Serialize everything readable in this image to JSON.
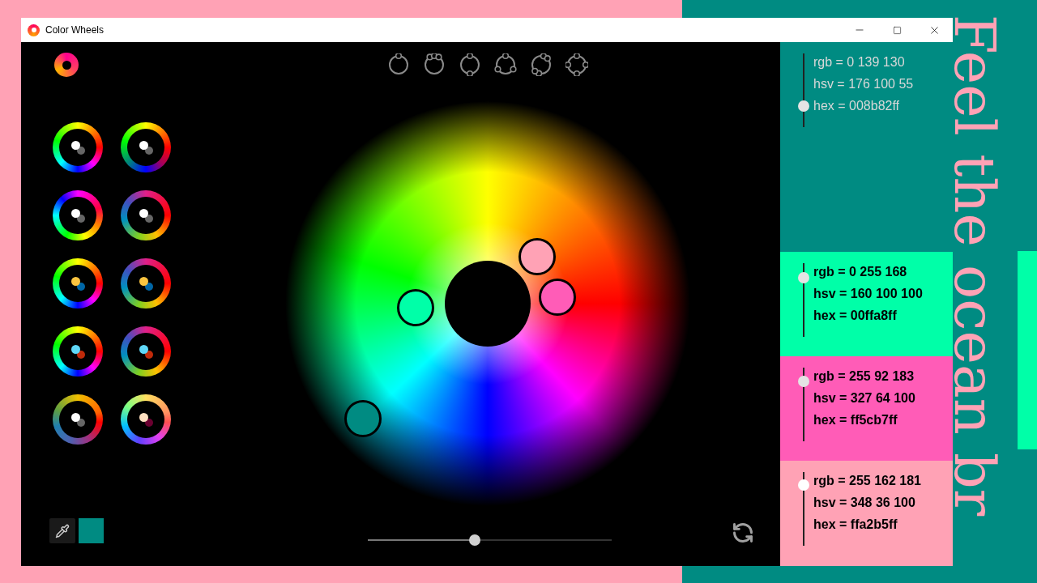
{
  "window": {
    "title": "Color Wheels"
  },
  "presets": [
    {
      "kind": "rgb",
      "dots": [
        {
          "color": "#ffffff"
        },
        {
          "color": "#666666"
        }
      ]
    },
    {
      "kind": "ryb",
      "dots": [
        {
          "color": "#ffffff"
        },
        {
          "color": "#666666"
        }
      ]
    },
    {
      "kind": "rotated",
      "dots": [
        {
          "color": "#ffffff"
        },
        {
          "color": "#666666"
        }
      ]
    },
    {
      "kind": "cool",
      "dots": [
        {
          "color": "#ffffff"
        },
        {
          "color": "#666666"
        }
      ]
    },
    {
      "kind": "rgb",
      "dots": [
        {
          "color": "#f9c440"
        },
        {
          "color": "#0066a6"
        }
      ]
    },
    {
      "kind": "cool",
      "dots": [
        {
          "color": "#f9c440"
        },
        {
          "color": "#0066a6"
        }
      ]
    },
    {
      "kind": "rgb",
      "dots": [
        {
          "color": "#5fd8f8"
        },
        {
          "color": "#c02a0a"
        }
      ]
    },
    {
      "kind": "cool",
      "dots": [
        {
          "color": "#5fd8f8"
        },
        {
          "color": "#c02a0a"
        }
      ]
    },
    {
      "kind": "muted",
      "dots": [
        {
          "color": "#ffffff"
        },
        {
          "color": "#666666"
        }
      ]
    },
    {
      "kind": "pastel",
      "dots": [
        {
          "color": "#ffe0c0"
        },
        {
          "color": "#6a0030"
        }
      ]
    }
  ],
  "brightness_slider": {
    "level": 0.44
  },
  "current_color": {
    "color": "#008b82"
  },
  "swatches": [
    {
      "color": "#008b82",
      "level": 0.29,
      "rgb": "rgb = 0 139 130",
      "hsv": "hsv = 176 100 55",
      "hex": "hex = 008b82ff"
    },
    {
      "color": "#00ffa8",
      "level": 0.8,
      "rgb": "rgb = 0 255 168",
      "hsv": "hsv = 160 100 100",
      "hex": "hex = 00ffa8ff"
    },
    {
      "color": "#ff5cb7",
      "level": 0.81,
      "rgb": "rgb = 255 92 183",
      "hsv": "hsv = 327 64 100",
      "hex": "hex = ff5cb7ff"
    },
    {
      "color": "#ffa2b5",
      "level": 0.82,
      "rgb": "rgb = 255 162 181",
      "hsv": "hsv = 348 36 100",
      "hex": "hex = ffa2b5ff"
    }
  ],
  "desktop": {
    "headline": "Feel the ocean br"
  }
}
